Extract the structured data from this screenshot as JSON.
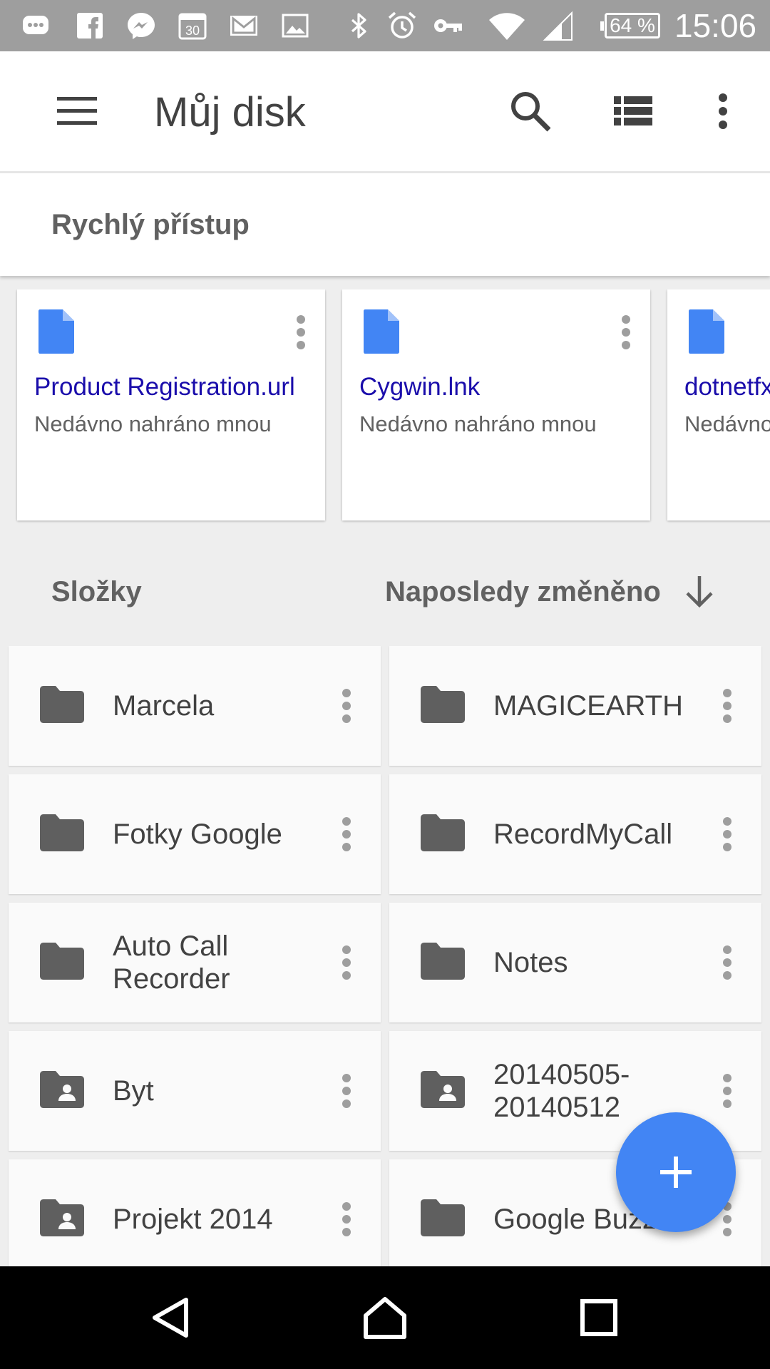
{
  "status_bar": {
    "battery": "64 %",
    "time": "15:06",
    "icons": [
      "messages-icon",
      "facebook-icon",
      "messenger-icon",
      "calendar-icon",
      "gmail-icon",
      "gallery-icon",
      "bluetooth-icon",
      "alarm-icon",
      "vpn-key-icon",
      "wifi-icon",
      "cell-signal-icon",
      "battery-icon"
    ],
    "calendar_day": "30"
  },
  "app_bar": {
    "title": "Můj disk",
    "actions": [
      "menu-icon",
      "search-icon",
      "list-view-icon",
      "more-vert-icon"
    ]
  },
  "quick_access": {
    "title": "Rychlý přístup",
    "items": [
      {
        "name": "Product Registration.url",
        "subtitle": "Nedávno nahráno mnou"
      },
      {
        "name": "Cygwin.lnk",
        "subtitle": "Nedávno nahráno mnou"
      },
      {
        "name": "dotnetfx",
        "subtitle": "Nedávno nahráno mnou"
      }
    ]
  },
  "folders": {
    "title": "Složky",
    "sort_label": "Naposledy změněno",
    "items": [
      {
        "name": "Marcela",
        "shared": false
      },
      {
        "name": "MAGICEARTH",
        "shared": false
      },
      {
        "name": "Fotky Google",
        "shared": false
      },
      {
        "name": "RecordMyCall",
        "shared": false
      },
      {
        "name": "Auto Call Recorder",
        "shared": false
      },
      {
        "name": "Notes",
        "shared": false
      },
      {
        "name": "Byt",
        "shared": true
      },
      {
        "name": "20140505-20140512",
        "shared": true
      },
      {
        "name": "Projekt 2014",
        "shared": true
      },
      {
        "name": "Google Buzz",
        "shared": false
      }
    ]
  },
  "colors": {
    "accent": "#4285f4",
    "status_bar": "#9e9e9e",
    "link": "#1a0dab",
    "folder_icon": "#5f5f5f"
  }
}
